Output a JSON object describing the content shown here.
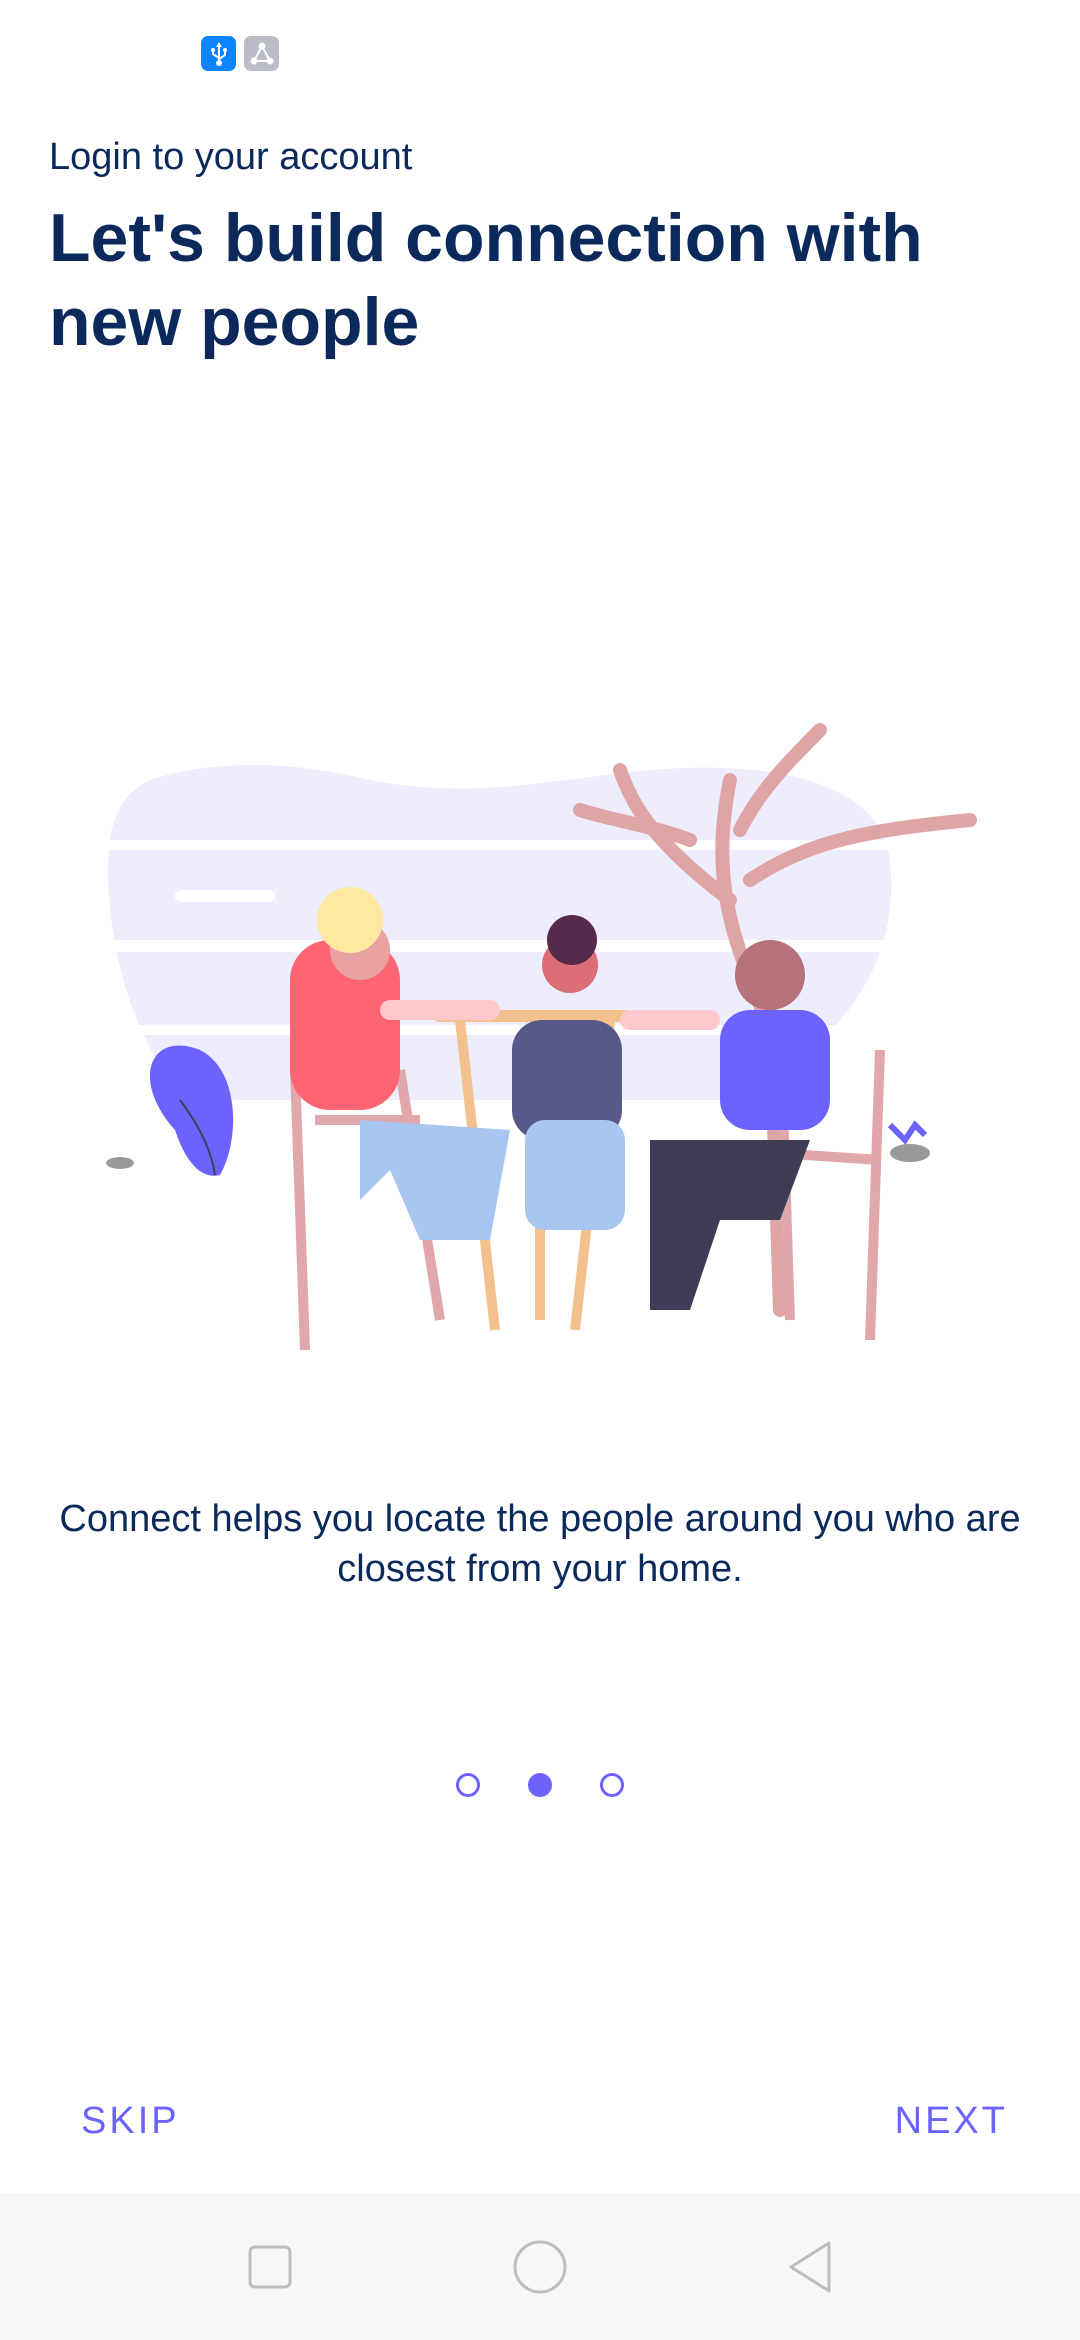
{
  "status_bar": {
    "icons": [
      "usb-icon",
      "hotspot-icon"
    ],
    "usb_color": "#0a84ff",
    "hotspot_color": "#babdc8"
  },
  "header": {
    "subtitle": "Login to your account",
    "title": "Let's build connection with new people"
  },
  "description": "Connect helps you locate the people around you who are closest from your home.",
  "pager": {
    "total": 3,
    "active_index": 1,
    "accent": "#6c63ff"
  },
  "buttons": {
    "skip": "SKIP",
    "next": "NEXT"
  },
  "nav_bar": {
    "items": [
      "recent-apps",
      "home",
      "back"
    ]
  }
}
